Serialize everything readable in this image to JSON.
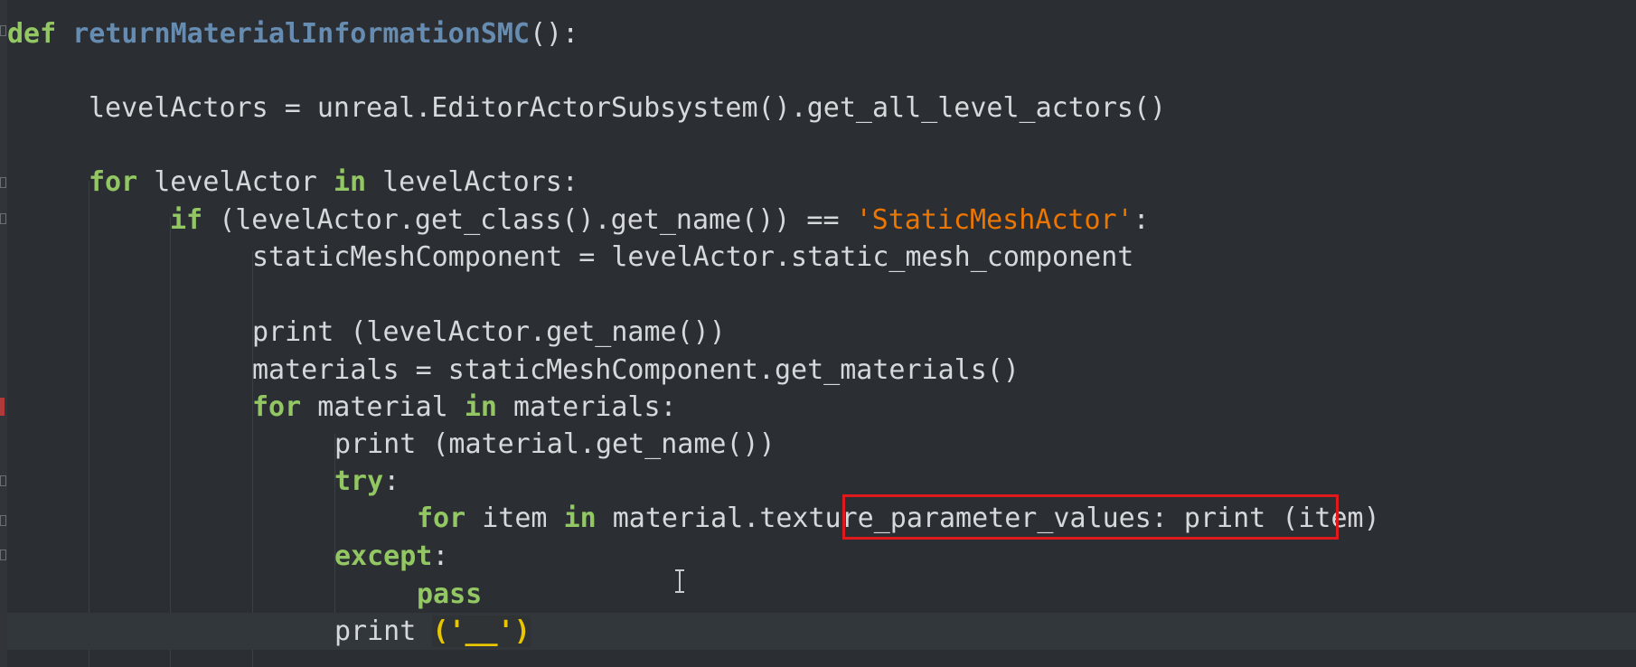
{
  "editor": {
    "language": "python",
    "colors": {
      "background": "#2b2f33",
      "keyword": "#93c763",
      "function_name": "#678cb1",
      "string": "#ec7600",
      "text": "#d6d9dc",
      "highlight_box": "#e0191c"
    },
    "lines": {
      "l1": {
        "kw_def": "def",
        "fn_name": "returnMaterialInformationSMC",
        "rest": "():"
      },
      "l2": {
        "text": "levelActors = unreal.EditorActorSubsystem().get_all_level_actors()"
      },
      "l3": {
        "kw_for": "for",
        "t1": " levelActor ",
        "kw_in": "in",
        "t2": " levelActors:"
      },
      "l4": {
        "kw_if": "if",
        "t1": " (levelActor.get_class().get_name()) == ",
        "str": "'StaticMeshActor'",
        "t2": ":"
      },
      "l5": {
        "text": "staticMeshComponent = levelActor.static_mesh_component"
      },
      "l6": {
        "text": "print (levelActor.get_name())"
      },
      "l7": {
        "text": "materials = staticMeshComponent.get_materials()"
      },
      "l8": {
        "kw_for": "for",
        "t1": " material ",
        "kw_in": "in",
        "t2": " materials:"
      },
      "l9": {
        "text": "print (material.get_name())"
      },
      "l10": {
        "kw_try": "try",
        "t1": ":"
      },
      "l11": {
        "kw_for": "for",
        "t1": " item ",
        "kw_in": "in",
        "t2": " material.",
        "highlighted": "texture_parameter_values",
        "t3": ": print (item)"
      },
      "l12": {
        "kw_except": "except",
        "t1": ":"
      },
      "l13": {
        "kw_pass": "pass"
      },
      "l14": {
        "t1": "print ",
        "paren_open": "(",
        "str": "'__'",
        "paren_close": ")"
      }
    },
    "cursor_icon": "text-cursor-icon"
  }
}
